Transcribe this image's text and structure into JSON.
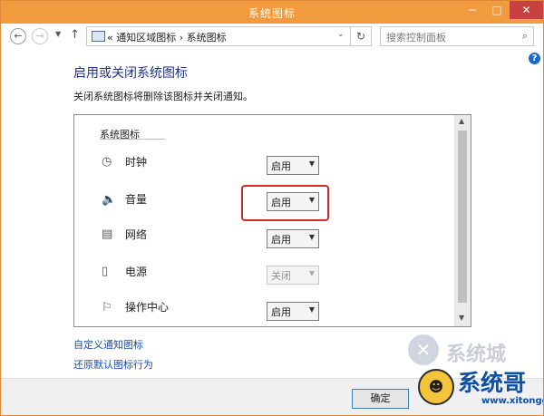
{
  "window": {
    "title": "系统图标",
    "controls": {
      "minimize": "−",
      "maximize": "□",
      "close": "✕"
    }
  },
  "addressbar": {
    "back_icon": "arrow-left-icon",
    "forward_icon": "arrow-right-icon",
    "recent_icon": "chevron-down-icon",
    "up_icon": "arrow-up-icon",
    "path": "« 通知区域图标 › 系统图标",
    "dropdown": "⌄",
    "refresh": "↻",
    "search_placeholder": "搜索控制面板",
    "search_icon": "⌕"
  },
  "help": "?",
  "main": {
    "heading": "启用或关闭系统图标",
    "description": "关闭系统图标将删除该图标并关闭通知。",
    "section_title": "系统图标",
    "rows": [
      {
        "label": "时钟",
        "icon": "clock-icon",
        "value": "启用",
        "disabled": false
      },
      {
        "label": "音量",
        "icon": "volume-icon",
        "value": "启用",
        "disabled": false
      },
      {
        "label": "网络",
        "icon": "network-icon",
        "value": "启用",
        "disabled": false
      },
      {
        "label": "电源",
        "icon": "power-icon",
        "value": "关闭",
        "disabled": true
      },
      {
        "label": "操作中心",
        "icon": "flag-icon",
        "value": "启用",
        "disabled": false
      }
    ],
    "highlight_color": "#d52a2a"
  },
  "links": {
    "customize": "自定义通知图标",
    "restore": "还原默认图标行为"
  },
  "footer": {
    "ok": "确定"
  },
  "watermark": {
    "top_text": "系统城",
    "brand": "系统哥",
    "url": "www.xitongge.com"
  },
  "colors": {
    "titlebar": "#f29a3e",
    "heading": "#1e3287",
    "link": "#1c4eaf"
  }
}
